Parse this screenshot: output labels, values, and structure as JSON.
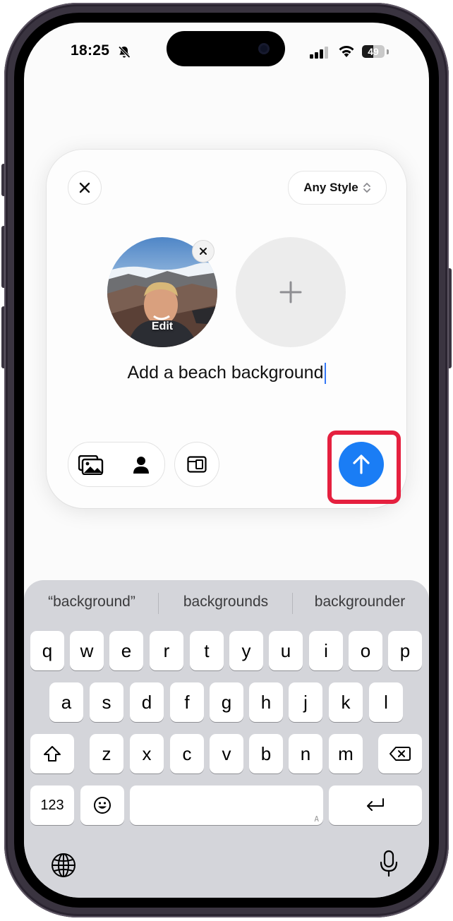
{
  "status_bar": {
    "time": "18:25",
    "battery": "49",
    "battery_level": 0.49
  },
  "composer": {
    "style_button_label": "Any Style",
    "avatar_edit_label": "Edit",
    "prompt_text": "Add a beach background",
    "accent_color": "#1a7df5",
    "highlight_color": "#e5203f"
  },
  "keyboard": {
    "suggestions": [
      "“background”",
      "backgrounds",
      "backgrounder"
    ],
    "row1": [
      "q",
      "w",
      "e",
      "r",
      "t",
      "y",
      "u",
      "i",
      "o",
      "p"
    ],
    "row2": [
      "a",
      "s",
      "d",
      "f",
      "g",
      "h",
      "j",
      "k",
      "l"
    ],
    "row3": [
      "z",
      "x",
      "c",
      "v",
      "b",
      "n",
      "m"
    ],
    "numbers_label": "123",
    "space_hint": "A"
  },
  "icons": [
    "bell-slash-icon",
    "signal-icon",
    "wifi-icon",
    "close-icon",
    "chevron-updown-icon",
    "plus-icon",
    "photos-icon",
    "person-icon",
    "layout-icon",
    "arrow-up-icon",
    "shift-icon",
    "delete-icon",
    "emoji-icon",
    "return-icon",
    "globe-icon",
    "microphone-icon"
  ]
}
